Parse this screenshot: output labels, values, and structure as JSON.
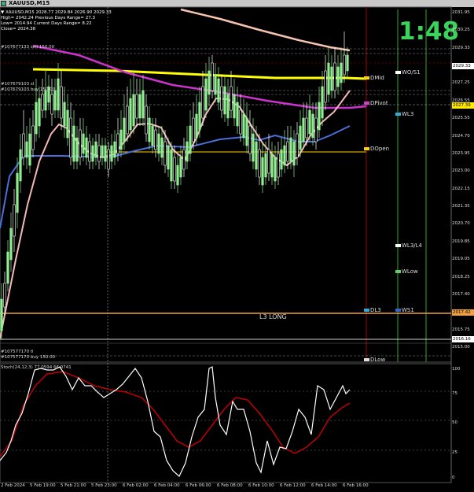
{
  "window": {
    "title": "XAUUSD,M15"
  },
  "info_panel": [
    "▼ XAUUSD,M15  2028.77 2029.84 2026.90 2029.33",
    "High= 2042.24    Previous Days Range= 27.3",
    "Low= 2014.94    Current Days Range= 8.22",
    "Close= 2024.38"
  ],
  "order_labels": {
    "sell": "#107677133 sell 150.00",
    "buy_a": "#107679103 sl",
    "buy_b": "#107679103 buy 150.00",
    "tp_a": "#107577170 tl",
    "tp_b": "#107577170 buy 150.00"
  },
  "timer": "1:48",
  "levels": {
    "dmid": "DMid",
    "dpivot": "DPivot",
    "dopen": "DOpen",
    "dl3": "DL3",
    "dlow": "DLow",
    "wo_s1": "WO/S1",
    "wl3": "WL3",
    "wl3_l4": "WL3/L4",
    "wlow": "WLow",
    "ws1": "WS1",
    "l3_long": "L3 LONG"
  },
  "price_axis": [
    "2031.95",
    "2030.25",
    "2029.33",
    "2027.90",
    "2027.25",
    "2026.55",
    "2025.55",
    "2024.70",
    "2023.95",
    "2023.00",
    "2022.15",
    "2021.35",
    "2020.70",
    "2019.85",
    "2019.05",
    "2018.25",
    "2017.40",
    "2016.55",
    "2015.75",
    "2015.00"
  ],
  "price_boxes": {
    "current": "2029.33",
    "dpivot": "2027.39",
    "orange": "2017.42",
    "white": "2016.16"
  },
  "stoch_label": "Stoch(24,12,3) 77.0594 66.0741",
  "stoch_axis": [
    "100",
    "75",
    "50",
    "25",
    "0"
  ],
  "time_axis": [
    "2 Feb 2024",
    "5 Feb 19:00",
    "5 Feb 21:00",
    "5 Feb 23:00",
    "6 Feb 02:00",
    "6 Feb 04:00",
    "6 Feb 06:00",
    "6 Feb 08:00",
    "6 Feb 10:00",
    "6 Feb 12:00",
    "6 Feb 14:00",
    "6 Feb 16:00"
  ],
  "colors": {
    "bull": "#90ee90",
    "bear": "#ffffff",
    "yellow": "#ffff00",
    "magenta": "#cc33cc",
    "blue": "#4a6fd8",
    "pink": "#f4b8b8",
    "orange": "#f0a040",
    "green": "#2a8a2a",
    "red": "#a00000"
  }
}
